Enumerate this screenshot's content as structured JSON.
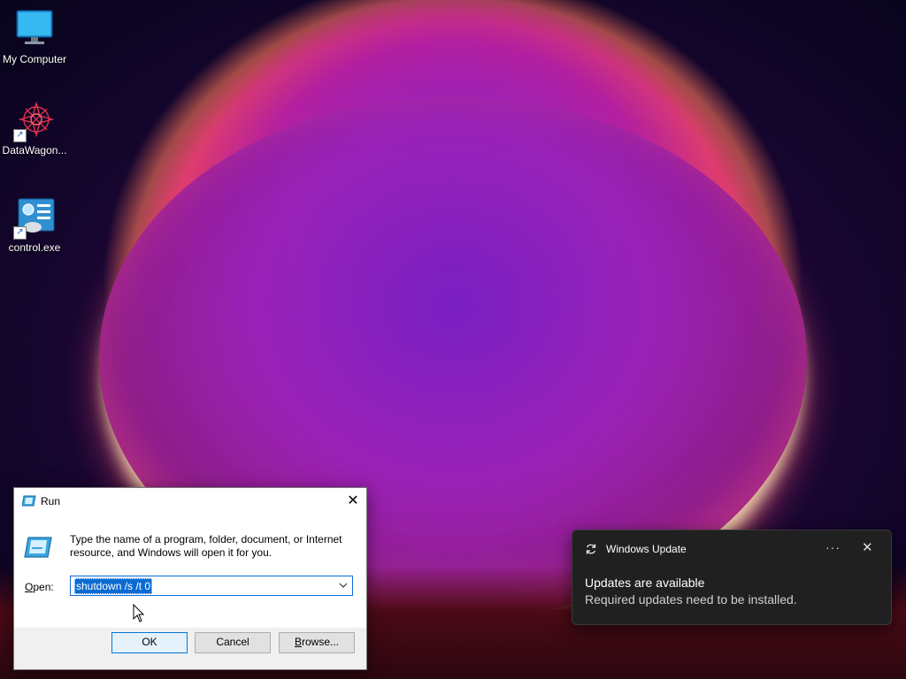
{
  "desktop": {
    "icons": [
      {
        "label": "My Computer",
        "icon": "monitor-icon"
      },
      {
        "label": "DataWagon...",
        "icon": "datawagon-icon"
      },
      {
        "label": "control.exe",
        "icon": "control-panel-icon"
      }
    ]
  },
  "run_dialog": {
    "title": "Run",
    "description": "Type the name of a program, folder, document, or Internet resource, and Windows will open it for you.",
    "open_label": "Open:",
    "open_value": "shutdown /s /t 0",
    "ok_label": "OK",
    "cancel_label": "Cancel",
    "browse_label": "Browse...",
    "accent": "#0a6cd3"
  },
  "toast": {
    "app_name": "Windows Update",
    "title": "Updates are available",
    "body": "Required updates need to be installed.",
    "more": "···",
    "close": "✕",
    "background": "#202020"
  }
}
